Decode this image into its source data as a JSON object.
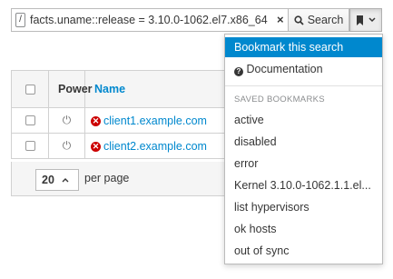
{
  "search": {
    "slash_icon": "/",
    "query": "facts.uname::release = 3.10.0-1062.el7.x86_64",
    "clear_icon": "×",
    "search_label": "Search",
    "search_icon": "magnifier-icon",
    "bookmark_icon": "bookmark-icon"
  },
  "table": {
    "headers": {
      "power": "Power",
      "name": "Name"
    },
    "rows": [
      {
        "name": "client1.example.com",
        "status": "error"
      },
      {
        "name": "client2.example.com",
        "status": "error"
      }
    ],
    "per_page_value": "20",
    "per_page_label": "per page"
  },
  "bookmark_menu": {
    "bookmark_this": "Bookmark this search",
    "documentation": "Documentation",
    "saved_header": "SAVED BOOKMARKS",
    "items": [
      "active",
      "disabled",
      "error",
      "Kernel 3.10.0-1062.1.1.el...",
      "list hypervisors",
      "ok hosts",
      "out of sync"
    ]
  },
  "colors": {
    "link": "#0088ce",
    "highlight": "#0088ce",
    "error": "#cc0000"
  }
}
